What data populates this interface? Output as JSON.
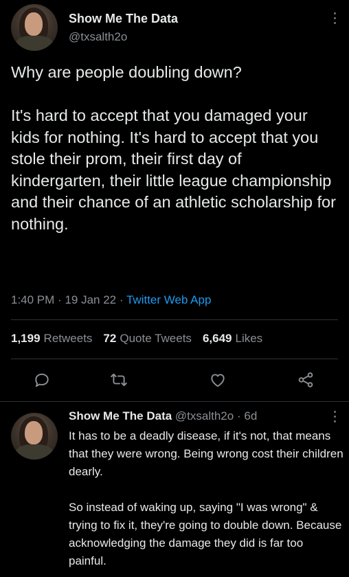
{
  "main_tweet": {
    "author_name": "Show Me The Data",
    "author_handle": "@txsalth2o",
    "text": "Why are people doubling down?\n\nIt's hard to accept that you damaged your kids for nothing. It's hard to accept that you stole their prom, their first day of kindergarten, their little league championship and their chance of an athletic scholarship for nothing.",
    "time": "1:40 PM",
    "date": "19 Jan 22",
    "separator": "·",
    "source_app": "Twitter Web App",
    "stats": {
      "retweets_count": "1,199",
      "retweets_label": "Retweets",
      "quotes_count": "72",
      "quotes_label": "Quote Tweets",
      "likes_count": "6,649",
      "likes_label": "Likes"
    },
    "actions": [
      "reply-icon",
      "retweet-icon",
      "like-icon",
      "share-icon"
    ]
  },
  "reply_tweet": {
    "author_name": "Show Me The Data",
    "author_handle": "@txsalth2o",
    "separator": "·",
    "age": "6d",
    "text": "It has to be a deadly disease, if it's not, that means that they were wrong. Being wrong cost their children dearly.\n\nSo instead of waking up, saying \"I was wrong\" & trying to fix it, they're going to double down. Because acknowledging the damage they did is far too painful."
  },
  "colors": {
    "background": "#000000",
    "text_primary": "#e7e9ea",
    "text_secondary": "#8b8f94",
    "link": "#1d9bf0",
    "divider": "#2f3336",
    "icon": "#8b8f94"
  }
}
